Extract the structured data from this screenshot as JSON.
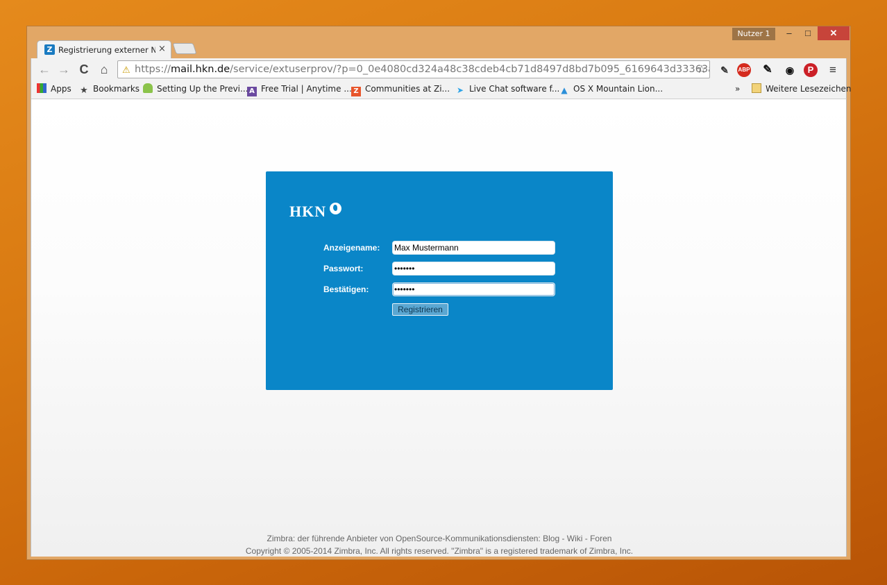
{
  "window": {
    "user_badge": "Nutzer 1",
    "min": "–",
    "max": "□",
    "close": "✕"
  },
  "tab": {
    "favicon": "Z",
    "title": "Registrierung externer Nutzer",
    "close": "×"
  },
  "toolbar": {
    "back": "←",
    "forward": "→",
    "reload": "C",
    "home": "⌂",
    "url_prefix": "https://",
    "url_host": "mail.hkn.de",
    "url_rest": "/service/extuserprov/?p=0_0e4080cd324a48c38cdeb4cb71d8497d8bd7b095_6169643d33363a",
    "star": "☆",
    "menu": "≡",
    "abp": "ABP",
    "pin": "P"
  },
  "bookmarks": [
    {
      "label": "Apps",
      "icon": "apps-grid-icon"
    },
    {
      "label": "Bookmarks",
      "icon": "star-icon"
    },
    {
      "label": "Setting Up the Previ...",
      "icon": "android-icon"
    },
    {
      "label": "Free Trial | Anytime ...",
      "icon": "a-icon"
    },
    {
      "label": "Communities at Zi...",
      "icon": "z-icon"
    },
    {
      "label": "Live Chat software f...",
      "icon": "bird-icon"
    },
    {
      "label": "OS X Mountain Lion...",
      "icon": "rocket-icon"
    }
  ],
  "bookmarks_more": "»",
  "other_bookmarks": "Weitere Lesezeichen",
  "form": {
    "logo": "HKN",
    "display_name_label": "Anzeigename:",
    "display_name_value": "Max Mustermann",
    "password_label": "Passwort:",
    "password_value": "•••••••",
    "confirm_label": "Bestätigen:",
    "confirm_value": "•••••••",
    "submit_label": "Registrieren"
  },
  "footer": {
    "line1": "Zimbra: der führende Anbieter von OpenSource-Kommunikationsdiensten: Blog - Wiki - Foren",
    "line2": "Copyright © 2005-2014 Zimbra, Inc. All rights reserved. \"Zimbra\" is a registered trademark of Zimbra, Inc."
  }
}
